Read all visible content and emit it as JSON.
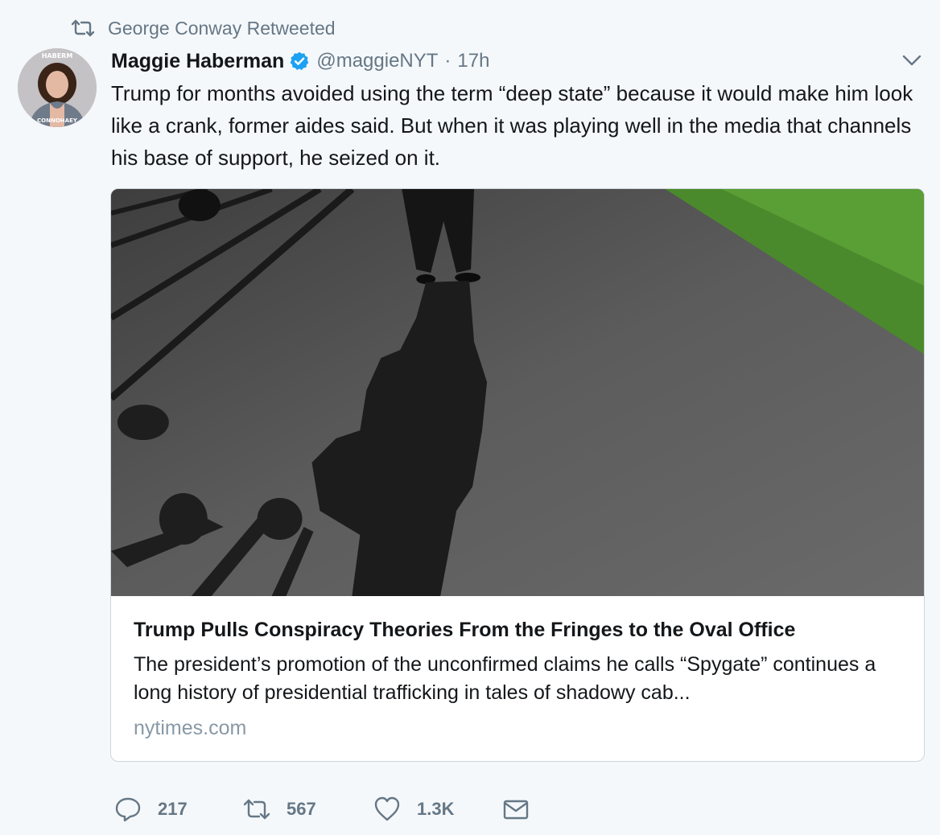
{
  "retweet_context": {
    "text": "George Conway Retweeted",
    "icon": "retweet-icon"
  },
  "author": {
    "name": "Maggie Haberman",
    "handle": "@maggieNYT",
    "separator": "·",
    "time": "17h",
    "verified": true,
    "avatar_text_top": "HABERM",
    "avatar_text_bottom": "CONNOHAEY"
  },
  "tweet_text": "Trump for months avoided using the term “deep state” because it would make him look like a crank, former aides said. But when it was playing well in the media that channels his base of support, he seized on it.",
  "card": {
    "title": "Trump Pulls Conspiracy Theories From the Fringes to the Oval Office",
    "description": "The president’s promotion of the unconfirmed claims he calls “Spygate” continues a long history of presidential trafficking in tales of shadowy cab...",
    "domain": "nytimes.com"
  },
  "actions": {
    "reply_count": "217",
    "retweet_count": "567",
    "like_count": "1.3K"
  },
  "colors": {
    "background": "#f5f8fa",
    "secondary_text": "#657786",
    "verified_blue": "#1da1f2",
    "card_border": "#ccd6dd",
    "domain_text": "#8899a6"
  }
}
